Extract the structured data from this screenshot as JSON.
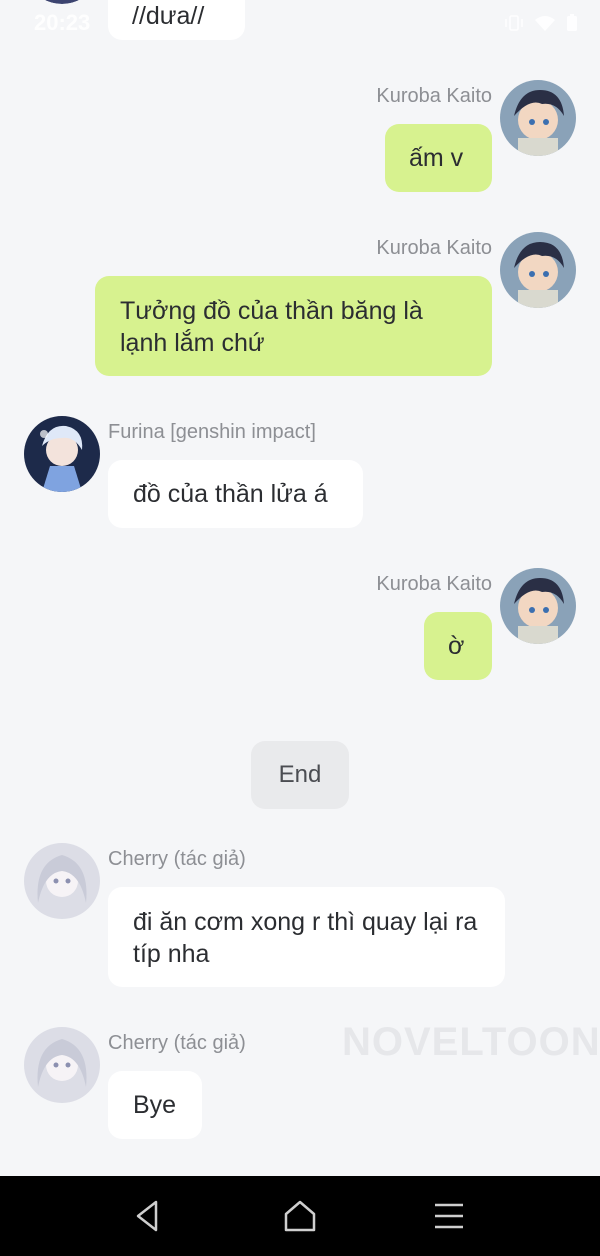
{
  "status_bar": {
    "time": "20:23"
  },
  "messages": [
    {
      "sender": "",
      "side": "left",
      "text": "//dưa//"
    },
    {
      "sender": "Kuroba Kaito",
      "side": "right",
      "text": "ấm v"
    },
    {
      "sender": "Kuroba Kaito",
      "side": "right",
      "text": "Tưởng đồ của thần băng là lạnh lắm chứ"
    },
    {
      "sender": "Furina  [genshin impact]",
      "side": "left",
      "text": "đồ của thần lửa á"
    },
    {
      "sender": "Kuroba Kaito",
      "side": "right",
      "text": "ờ"
    },
    {
      "sender": "Cherry (tác giả)",
      "side": "left",
      "text": "đi ăn cơm xong r thì quay lại ra típ nha"
    },
    {
      "sender": "Cherry (tác giả)",
      "side": "left",
      "text": "Bye"
    }
  ],
  "end_label": "End",
  "watermark": "NOVELTOON",
  "nav": {
    "back": "back-icon",
    "home": "home-icon",
    "menu": "menu-icon"
  },
  "colors": {
    "outgoing_bubble": "#d7f28f",
    "incoming_bubble": "#ffffff",
    "background": "#f5f6f8"
  }
}
